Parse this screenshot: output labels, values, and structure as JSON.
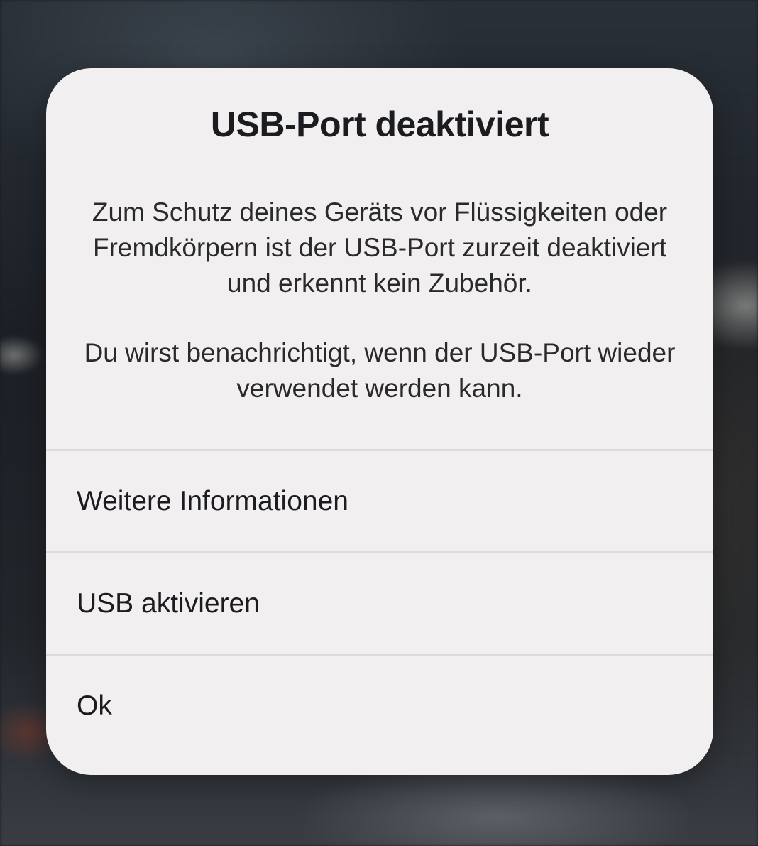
{
  "dialog": {
    "title": "USB-Port deaktiviert",
    "message_paragraph_1": "Zum Schutz deines Geräts vor Flüssigkeiten oder Fremdkörpern ist der USB-Port zurzeit deaktiviert und erkennt kein Zubehör.",
    "message_paragraph_2": "Du wirst benachrichtigt, wenn der USB-Port wieder verwendet werden kann.",
    "actions": [
      {
        "label": "Weitere Informationen"
      },
      {
        "label": "USB aktivieren"
      },
      {
        "label": "Ok"
      }
    ]
  },
  "colors": {
    "dialog_background": "#f1eff0",
    "divider": "#dcdadb",
    "text": "#1c1b1f"
  }
}
